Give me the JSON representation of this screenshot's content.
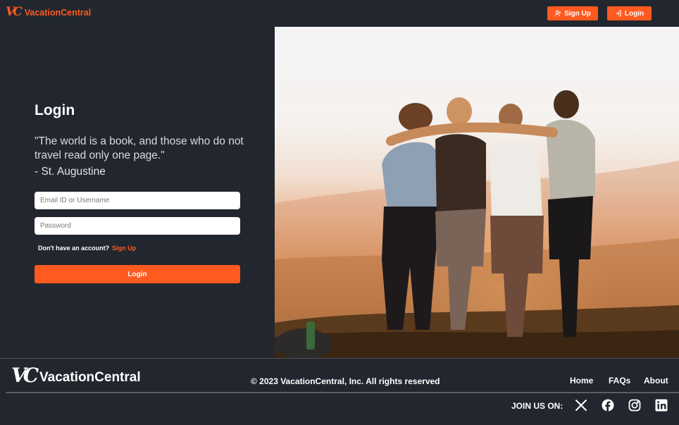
{
  "header": {
    "logo_mark": "VC",
    "brand_name": "VacationCentral",
    "signup_label": "Sign Up",
    "login_label": "Login"
  },
  "login": {
    "title": "Login",
    "quote": "\"The world is a book, and those who do not travel read only one page.\"",
    "author": "- St. Augustine",
    "email_placeholder": "Email ID or Username",
    "password_placeholder": "Password",
    "no_account_text": "Don't have an account?",
    "signup_link": "Sign Up",
    "submit_label": "Login"
  },
  "footer": {
    "logo_mark": "VC",
    "brand_name": "VacationCentral",
    "copyright": "© 2023 VacationCentral, Inc. All rights reserved",
    "links": [
      "Home",
      "FAQs",
      "About"
    ],
    "join_label": "JOIN US ON:",
    "social_icons": [
      "x-icon",
      "facebook-icon",
      "instagram-icon",
      "linkedin-icon"
    ]
  },
  "colors": {
    "accent": "#ff5a1f",
    "background": "#22262e"
  }
}
